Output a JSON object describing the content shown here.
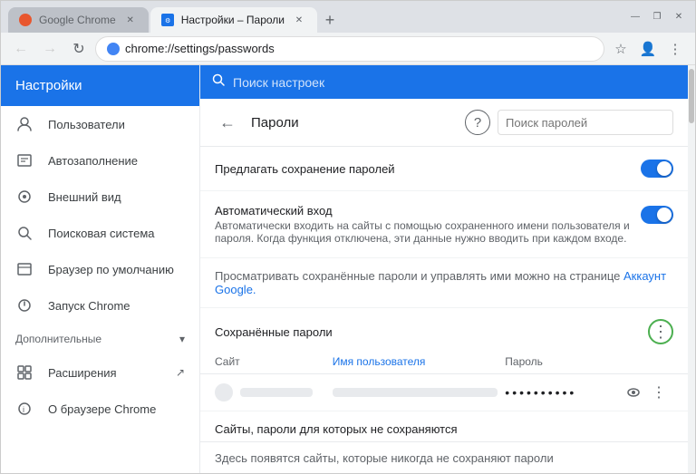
{
  "window": {
    "tabs": [
      {
        "id": "tab-1",
        "favicon_color": "#e8562e",
        "label": "Google Chrome",
        "active": false
      },
      {
        "id": "tab-2",
        "favicon_color": "#1a73e8",
        "label": "Настройки – Пароли",
        "active": true
      }
    ],
    "new_tab_label": "+",
    "controls": {
      "minimize": "—",
      "maximize": "❐",
      "close": "✕"
    }
  },
  "toolbar": {
    "back_label": "←",
    "forward_label": "→",
    "refresh_label": "↻",
    "address": "Chrome | chrome://settings/passwords",
    "address_display": "chrome://settings/passwords",
    "star_label": "☆",
    "account_label": "👤",
    "menu_label": "⋮"
  },
  "sidebar": {
    "header": "Настройки",
    "items": [
      {
        "id": "users",
        "icon": "👤",
        "label": "Пользователи"
      },
      {
        "id": "autofill",
        "icon": "📋",
        "label": "Автозаполнение"
      },
      {
        "id": "appearance",
        "icon": "🎨",
        "label": "Внешний вид"
      },
      {
        "id": "search",
        "icon": "🔍",
        "label": "Поисковая система"
      },
      {
        "id": "browser-default",
        "icon": "🖥",
        "label": "Браузер по умолчанию"
      },
      {
        "id": "startup",
        "icon": "⏻",
        "label": "Запуск Chrome"
      }
    ],
    "additional_section": "Дополнительные",
    "extensions": {
      "label": "Расширения",
      "icon": "🔧",
      "ext_icon": "↗"
    },
    "about": {
      "label": "О браузере Chrome",
      "icon": ""
    }
  },
  "search": {
    "placeholder": "Поиск настроек"
  },
  "passwords_page": {
    "back_label": "←",
    "title": "Пароли",
    "help_label": "?",
    "search_placeholder": "Поиск паролей",
    "settings": [
      {
        "id": "offer-save",
        "label": "Предлагать сохранение паролей",
        "desc": "",
        "toggle": true
      },
      {
        "id": "auto-login",
        "label": "Автоматический вход",
        "desc": "Автоматически входить на сайты с помощью сохраненного имени пользователя и пароля. Когда функция отключена, эти данные нужно вводить при каждом входе.",
        "toggle": true
      }
    ],
    "info_text": "Просматривать сохранённые пароли и управлять ими можно на странице ",
    "info_link": "Аккаунт Google.",
    "saved_section_title": "Сохранённые пароли",
    "more_btn_label": "⋮",
    "table_headers": {
      "site": "Сайт",
      "username": "Имя пользователя",
      "password": "Пароль"
    },
    "password_rows": [
      {
        "site_placeholder": "",
        "username_placeholder": "",
        "password_dots": "••••••••••",
        "show_btn": "👁",
        "more_btn": "⋮"
      }
    ],
    "no_save_section_title": "Сайты, пароли для которых не сохраняются",
    "no_save_empty": "Здесь появятся сайты, которые никогда не сохраняют пароли"
  }
}
